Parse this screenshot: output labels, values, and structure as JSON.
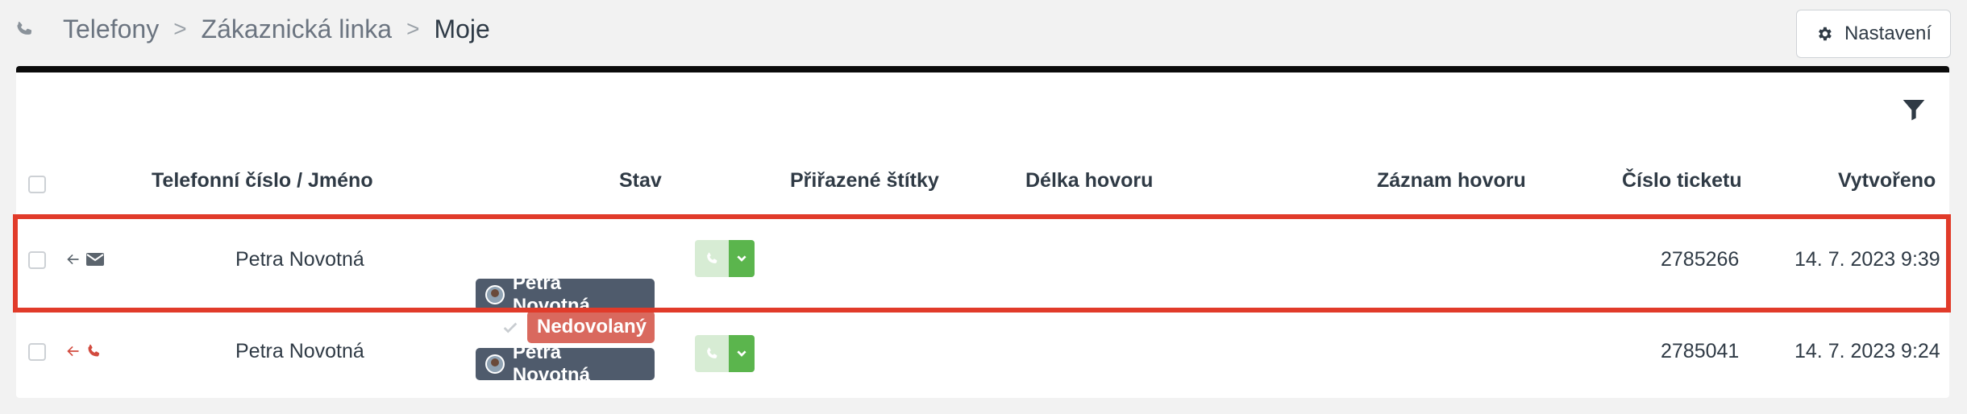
{
  "breadcrumb": {
    "icon": "phone-icon",
    "items": [
      "Telefony",
      "Zákaznická linka",
      "Moje"
    ],
    "separator": ">"
  },
  "settings": {
    "label": "Nastavení",
    "icon": "gear-icon"
  },
  "table": {
    "headers": {
      "phone_name": "Telefonní číslo / Jméno",
      "status": "Stav",
      "tags": "Přiřazené štítky",
      "duration": "Délka hovoru",
      "recording": "Záznam hovoru",
      "ticket": "Číslo ticketu",
      "created": "Vytvořeno"
    },
    "rows": [
      {
        "direction_icon": "arrow-left-icon",
        "channel_icon": "envelope-icon",
        "name": "Petra Novotná",
        "status_badge": "",
        "agent": "Petra Novotná",
        "ticket": "2785266",
        "created": "14. 7. 2023 9:39",
        "highlighted": true
      },
      {
        "direction_icon": "arrow-left-icon",
        "channel_icon": "phone-icon",
        "name": "Petra Novotná",
        "status_badge": "Nedovolaný",
        "agent": "Petra Novotná",
        "ticket": "2785041",
        "created": "14. 7. 2023 9:24",
        "highlighted": false
      }
    ]
  },
  "colors": {
    "highlight": "#e13b2a",
    "agent_badge": "#4f5b6c",
    "missed_badge": "#d9695e",
    "call_green": "#5bb54d",
    "missed_icon": "#d24b3f"
  }
}
